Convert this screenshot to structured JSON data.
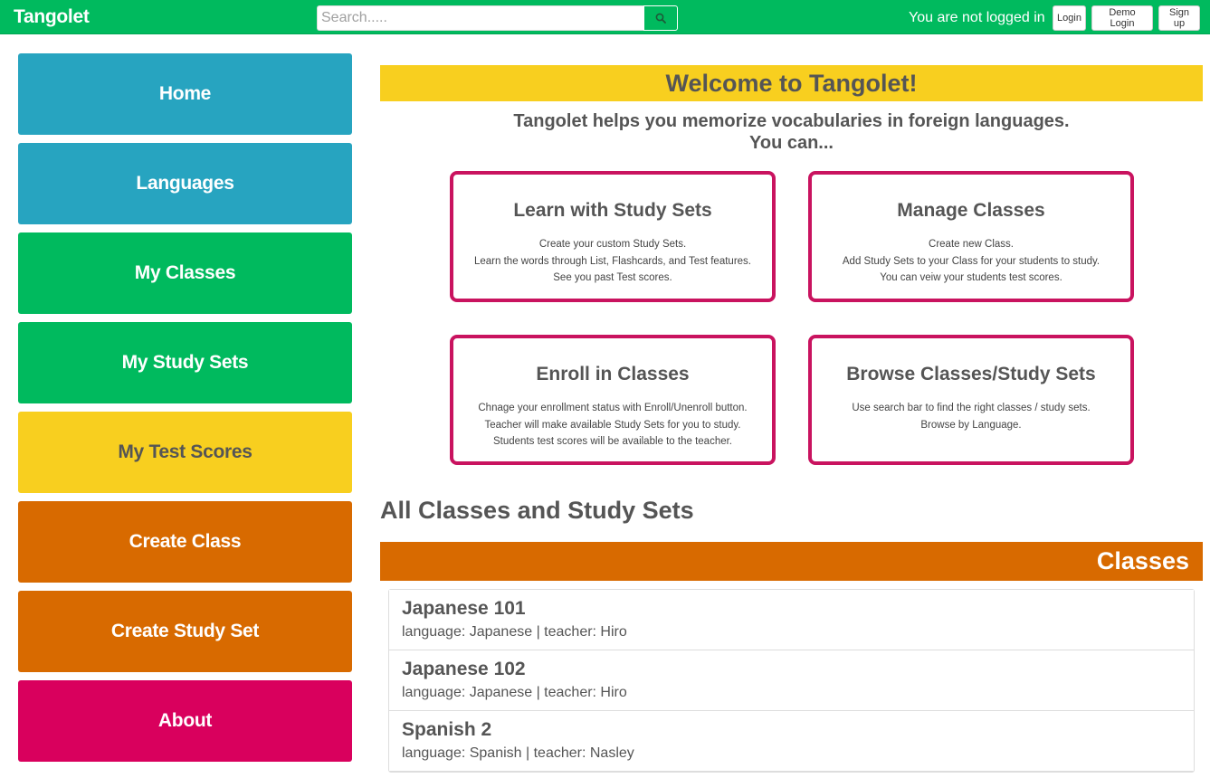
{
  "navbar": {
    "brand": "Tangolet",
    "search_placeholder": "Search.....",
    "status": "You are not logged in",
    "login": "Login",
    "demo_login": "Demo Login",
    "signup": "Sign up"
  },
  "sidebar": {
    "items": [
      {
        "label": "Home",
        "color": "#27a4c0"
      },
      {
        "label": "Languages",
        "color": "#27a4c0"
      },
      {
        "label": "My Classes",
        "color": "#00ba5e"
      },
      {
        "label": "My Study Sets",
        "color": "#00ba5e"
      },
      {
        "label": "My Test Scores",
        "color": "#f8cf1f"
      },
      {
        "label": "Create Class",
        "color": "#d86a00"
      },
      {
        "label": "Create Study Set",
        "color": "#d86a00"
      },
      {
        "label": "About",
        "color": "#d9005d"
      }
    ]
  },
  "main": {
    "welcome": "Welcome to Tangolet!",
    "intro_line1": "Tangolet helps you memorize vocabularies in foreign languages.",
    "intro_line2": "You can...",
    "features": [
      {
        "title": "Learn with Study Sets",
        "lines": [
          "Create your custom Study Sets.",
          "Learn the words through List, Flashcards, and Test features.",
          "See you past Test scores."
        ]
      },
      {
        "title": "Manage Classes",
        "lines": [
          "Create new Class.",
          "Add Study Sets to your Class for your students to study.",
          "You can veiw your students test scores."
        ]
      },
      {
        "title": "Enroll in Classes",
        "lines": [
          "Chnage your enrollment status with Enroll/Unenroll button.",
          "Teacher will make available Study Sets for you to study.",
          "Students test scores will be available to the teacher."
        ]
      },
      {
        "title": "Browse Classes/Study Sets",
        "lines": [
          "Use search bar to find the right classes / study sets.",
          "Browse by Language."
        ]
      }
    ],
    "section_title": "All Classes and Study Sets",
    "classes_header": "Classes",
    "classes": [
      {
        "name": "Japanese 101",
        "meta": "language: Japanese | teacher: Hiro"
      },
      {
        "name": "Japanese 102",
        "meta": "language: Japanese | teacher: Hiro"
      },
      {
        "name": "Spanish 2",
        "meta": "language: Spanish | teacher: Nasley"
      }
    ]
  },
  "colors": {
    "brand_green": "#00ba5e",
    "blue": "#27a4c0",
    "yellow": "#f8cf1f",
    "orange": "#d86a00",
    "magenta": "#d9005d",
    "card_border": "#c9135f"
  }
}
